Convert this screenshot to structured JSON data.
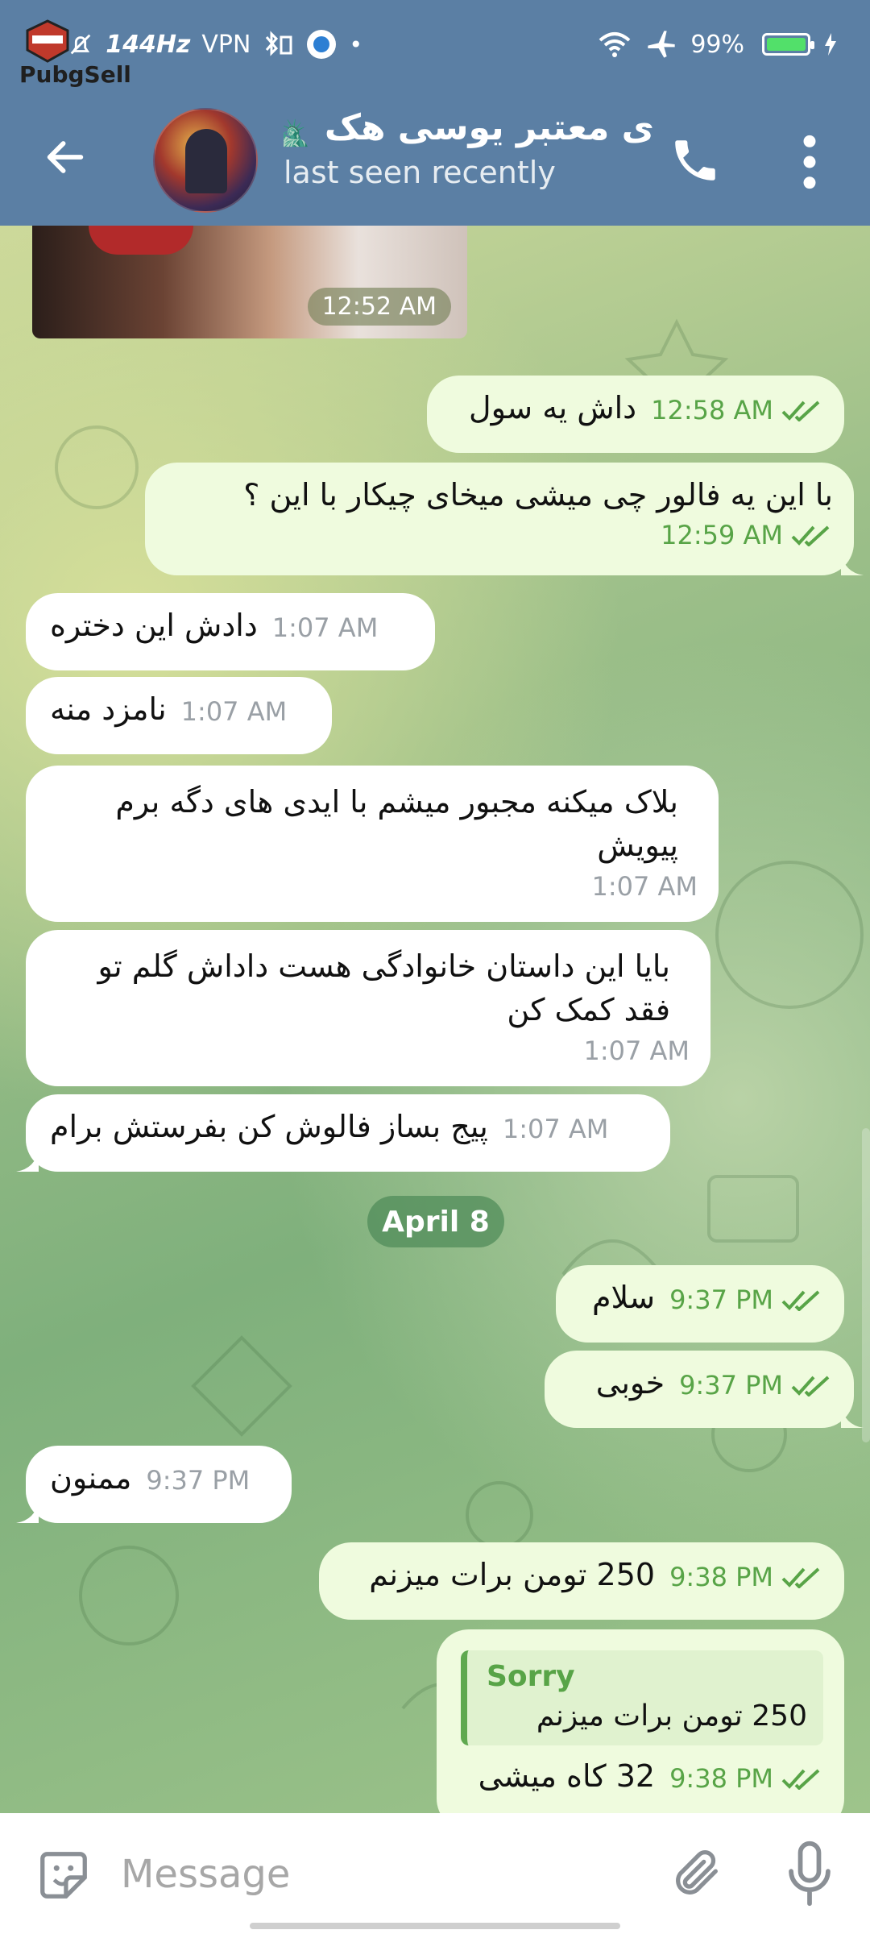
{
  "status_bar": {
    "time": "2:",
    "refresh": "144Hz",
    "vpn": "VPN",
    "battery": "99%",
    "battery_level": 0.99,
    "logo_text": "PubgSell"
  },
  "header": {
    "title": "ی معتبر یوسی هک 🗽",
    "subtitle": "last seen recently"
  },
  "media": {
    "time": "12:52 AM"
  },
  "messages": [
    {
      "dir": "out",
      "text": "داش یه سول",
      "time": "12:58 AM"
    },
    {
      "dir": "out",
      "text": "با این یه فالور چی میشی میخای چیکار با این ؟",
      "time": "12:59 AM"
    },
    {
      "dir": "in",
      "text": "دادش این دختره",
      "time": "1:07 AM"
    },
    {
      "dir": "in",
      "text": "نامزد منه",
      "time": "1:07 AM"
    },
    {
      "dir": "in",
      "text": "بلاک میکنه مجبور میشم با ایدی های دگه برم پیویش",
      "time": "1:07 AM"
    },
    {
      "dir": "in",
      "text": "بایا این داستان خانوادگی هست داداش گلم تو فقد کمک کن",
      "time": "1:07 AM"
    },
    {
      "dir": "in",
      "text": "پیج بساز فالوش کن بفرستش برام",
      "time": "1:07 AM"
    },
    {
      "dir": "out",
      "text": "سلام",
      "time": "9:37 PM"
    },
    {
      "dir": "out",
      "text": "خوبی",
      "time": "9:37 PM"
    },
    {
      "dir": "in",
      "text": "ممنون",
      "time": "9:37 PM"
    },
    {
      "dir": "out",
      "text": "250 تومن برات میزنم",
      "time": "9:38 PM"
    },
    {
      "dir": "out",
      "text": "32 کاه میشی",
      "time": "9:38 PM",
      "reply_name": "Sorry",
      "reply_text": "250 تومن برات میزنم"
    }
  ],
  "date_separator": "April 8",
  "composer": {
    "placeholder": "Message"
  },
  "colors": {
    "header": "#5b7fa4",
    "outgoing_bubble": "#effbde",
    "incoming_bubble": "#ffffff",
    "accent_green": "#58a447"
  },
  "icons": [
    "back-arrow-icon",
    "phone-icon",
    "more-vert-icon",
    "sticker-icon",
    "attach-icon",
    "mic-icon",
    "double-check-icon"
  ]
}
